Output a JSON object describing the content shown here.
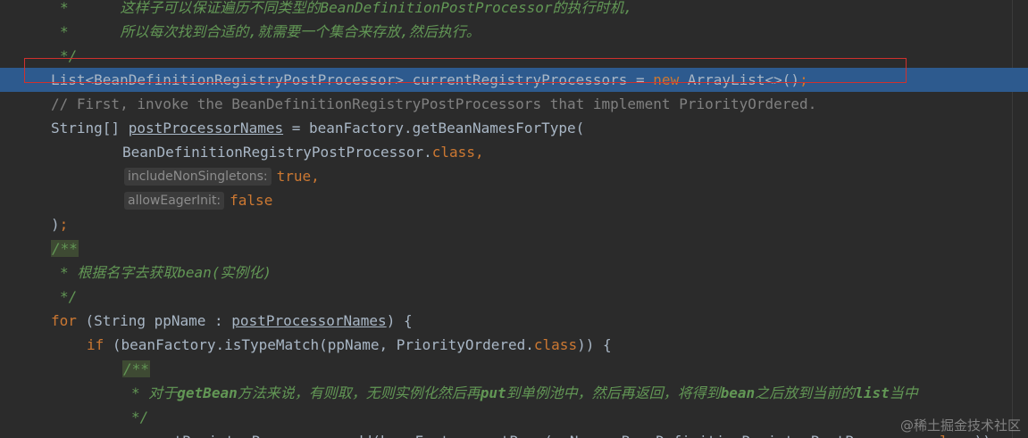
{
  "editor": {
    "lines": [
      {
        "indent": 67,
        "segments": [
          {
            "text": "*      这样子可以保证遍历不同类型的BeanDefinitionPostProcessor的执行时机,",
            "cls": "c-cm"
          }
        ]
      },
      {
        "indent": 67,
        "segments": [
          {
            "text": "*      所以每次找到合适的,就需要一个集合来存放,然后执行。",
            "cls": "c-cm"
          }
        ]
      },
      {
        "indent": 67,
        "segments": [
          {
            "text": "*/",
            "cls": "c-cm"
          }
        ]
      },
      {
        "indent": 57,
        "current": true,
        "segments": [
          {
            "text": "List<BeanDefinitionRegistryPostProcessor> currentRegistryProcessors = ",
            "cls": "c-tx"
          },
          {
            "text": "new",
            "cls": "c-kw"
          },
          {
            "text": " ArrayList<>()",
            "cls": "c-tx"
          },
          {
            "text": ";",
            "cls": "c-kw"
          }
        ]
      },
      {
        "indent": 57,
        "segments": [
          {
            "text": "// First, invoke the BeanDefinitionRegistryPostProcessors that implement PriorityOrdered.",
            "cls": "c-ln"
          }
        ]
      },
      {
        "indent": 57,
        "segments": [
          {
            "text": "String[] ",
            "cls": "c-tx"
          },
          {
            "text": "postProcessorNames",
            "cls": "c-ul"
          },
          {
            "text": " = beanFactory.getBeanNamesForType(",
            "cls": "c-tx"
          }
        ]
      },
      {
        "indent": 137,
        "segments": [
          {
            "text": "BeanDefinitionRegistryPostProcessor.",
            "cls": "c-tx"
          },
          {
            "text": "class",
            "cls": "c-kw"
          },
          {
            "text": ",",
            "cls": "c-kw"
          }
        ]
      },
      {
        "indent": 139,
        "segments": [
          {
            "text": "includeNonSingletons:",
            "cls": "hint"
          },
          {
            "text": "true",
            "cls": "c-cn"
          },
          {
            "text": ",",
            "cls": "c-kw"
          }
        ]
      },
      {
        "indent": 139,
        "segments": [
          {
            "text": "allowEagerInit:",
            "cls": "hint"
          },
          {
            "text": "false",
            "cls": "c-cn"
          }
        ]
      },
      {
        "indent": 57,
        "segments": [
          {
            "text": ")",
            "cls": "c-tx"
          },
          {
            "text": ";",
            "cls": "c-kw"
          }
        ]
      },
      {
        "indent": 57,
        "segments": [
          {
            "text": "/**",
            "cls": "doc-open"
          }
        ]
      },
      {
        "indent": 67,
        "segments": [
          {
            "text": "* 根据名字去获取bean(实例化)",
            "cls": "c-cm"
          }
        ]
      },
      {
        "indent": 67,
        "segments": [
          {
            "text": "*/",
            "cls": "c-cm"
          }
        ]
      },
      {
        "indent": 57,
        "segments": [
          {
            "text": "for",
            "cls": "c-kw"
          },
          {
            "text": " (String ppName : ",
            "cls": "c-tx"
          },
          {
            "text": "postProcessorNames",
            "cls": "c-ul"
          },
          {
            "text": ") {",
            "cls": "c-tx"
          }
        ]
      },
      {
        "indent": 97,
        "segments": [
          {
            "text": "if",
            "cls": "c-kw"
          },
          {
            "text": " (beanFactory.isTypeMatch(ppName, PriorityOrdered.",
            "cls": "c-tx"
          },
          {
            "text": "class",
            "cls": "c-kw"
          },
          {
            "text": ")) {",
            "cls": "c-tx"
          }
        ]
      },
      {
        "indent": 137,
        "segments": [
          {
            "text": "/**",
            "cls": "doc-open"
          }
        ]
      },
      {
        "indent": 147,
        "segments": [
          {
            "text": "* 对于",
            "cls": "c-cm"
          },
          {
            "text": "getBean",
            "cls": "c-bg"
          },
          {
            "text": "方法来说，有则取，无则实例化然后再",
            "cls": "c-cm"
          },
          {
            "text": "put",
            "cls": "c-bg"
          },
          {
            "text": "到单例池中，然后再返回，将得到",
            "cls": "c-cm"
          },
          {
            "text": "bean",
            "cls": "c-bg"
          },
          {
            "text": "之后放到当前的",
            "cls": "c-cm"
          },
          {
            "text": "list",
            "cls": "c-bg"
          },
          {
            "text": "当中",
            "cls": "c-cm"
          }
        ]
      },
      {
        "indent": 147,
        "segments": [
          {
            "text": "*/",
            "cls": "c-cm"
          }
        ]
      },
      {
        "indent": 137,
        "segments": [
          {
            "text": "currentRegistryProcessors.add(beanFactory.getBean(ppName, BeanDefinitionRegistryPostProcessor.",
            "cls": "c-tx"
          },
          {
            "text": "class",
            "cls": "c-kw"
          },
          {
            "text": "))",
            "cls": "c-tx"
          }
        ]
      }
    ]
  },
  "watermark": "@稀土掘金技术社区"
}
